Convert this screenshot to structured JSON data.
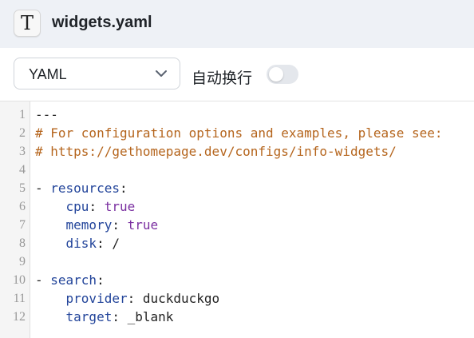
{
  "window": {
    "title": "widgets.yaml",
    "icon": "text-editor-icon",
    "icon_glyph": "T"
  },
  "toolbar": {
    "language_select": {
      "selected": "YAML",
      "options": [
        "YAML"
      ]
    },
    "word_wrap": {
      "label": "自动换行",
      "enabled": false
    }
  },
  "editor": {
    "line_numbers": [
      "1",
      "2",
      "3",
      "4",
      "5",
      "6",
      "7",
      "8",
      "9",
      "10",
      "11",
      "12"
    ],
    "lines": [
      {
        "n": "1",
        "tokens": [
          {
            "t": "---",
            "c": "plain"
          }
        ]
      },
      {
        "n": "2",
        "tokens": [
          {
            "t": "# For configuration options and examples, please see:",
            "c": "comment"
          }
        ]
      },
      {
        "n": "3",
        "tokens": [
          {
            "t": "# https://gethomepage.dev/configs/info-widgets/",
            "c": "comment"
          }
        ]
      },
      {
        "n": "4",
        "tokens": []
      },
      {
        "n": "5",
        "tokens": [
          {
            "t": "- ",
            "c": "plain"
          },
          {
            "t": "resources",
            "c": "key"
          },
          {
            "t": ":",
            "c": "plain"
          }
        ]
      },
      {
        "n": "6",
        "tokens": [
          {
            "t": "    ",
            "c": "plain"
          },
          {
            "t": "cpu",
            "c": "key"
          },
          {
            "t": ": ",
            "c": "plain"
          },
          {
            "t": "true",
            "c": "bool"
          }
        ]
      },
      {
        "n": "7",
        "tokens": [
          {
            "t": "    ",
            "c": "plain"
          },
          {
            "t": "memory",
            "c": "key"
          },
          {
            "t": ": ",
            "c": "plain"
          },
          {
            "t": "true",
            "c": "bool"
          }
        ]
      },
      {
        "n": "8",
        "tokens": [
          {
            "t": "    ",
            "c": "plain"
          },
          {
            "t": "disk",
            "c": "key"
          },
          {
            "t": ": /",
            "c": "plain"
          }
        ]
      },
      {
        "n": "9",
        "tokens": []
      },
      {
        "n": "10",
        "tokens": [
          {
            "t": "- ",
            "c": "plain"
          },
          {
            "t": "search",
            "c": "key"
          },
          {
            "t": ":",
            "c": "plain"
          }
        ]
      },
      {
        "n": "11",
        "tokens": [
          {
            "t": "    ",
            "c": "plain"
          },
          {
            "t": "provider",
            "c": "key"
          },
          {
            "t": ": duckduckgo",
            "c": "plain"
          }
        ]
      },
      {
        "n": "12",
        "tokens": [
          {
            "t": "    ",
            "c": "plain"
          },
          {
            "t": "target",
            "c": "key"
          },
          {
            "t": ": _blank",
            "c": "plain"
          }
        ]
      }
    ]
  },
  "colors": {
    "comment": "#b5651d",
    "key": "#22449a",
    "bool": "#7a2fa0",
    "plain": "#222222",
    "titlebar_bg": "#eef1f6"
  }
}
